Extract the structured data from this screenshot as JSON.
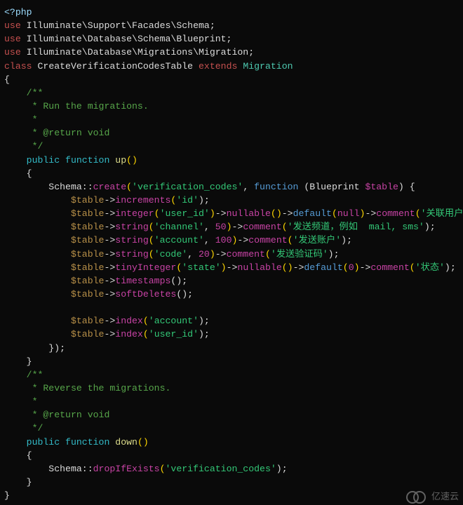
{
  "lines": {
    "l1": "<?php",
    "l2_use": "use",
    "l2_ns": " Illuminate\\Support\\Facades\\Schema;",
    "l3_use": "use",
    "l3_ns": " Illuminate\\Database\\Schema\\Blueprint;",
    "l4_use": "use",
    "l4_ns": " Illuminate\\Database\\Migrations\\Migration;",
    "l5_class": "class",
    "l5_name": " CreateVerificationCodesTable ",
    "l5_ext": "extends",
    "l5_parent": " Migration",
    "l6": "{",
    "l7": "    /**",
    "l8": "     * Run the migrations.",
    "l9": "     *",
    "l10": "     * @return void",
    "l11": "     */",
    "l12_pub": "    public",
    "l12_func": " function ",
    "l12_name": "up",
    "l12_paren": "()",
    "l13": "    {",
    "l14_schema": "        Schema",
    "l14_dcolon": "::",
    "l14_create": "create",
    "l14_open": "(",
    "l14_str": "'verification_codes'",
    "l14_comma": ", ",
    "l14_fn": "function ",
    "l14_op2": "(",
    "l14_bp": "Blueprint ",
    "l14_var": "$table",
    "l14_cl2": ") {",
    "l15_var": "            $table",
    "l15_arr": "->",
    "l15_m": "increments",
    "l15_op": "(",
    "l15_s": "'id'",
    "l15_cl": ");",
    "l16_var": "            $table",
    "l16_arr": "->",
    "l16_m1": "integer",
    "l16_op": "(",
    "l16_s1": "'user_id'",
    "l16_cl1": ")",
    "l16_a2": "->",
    "l16_m2": "nullable",
    "l16_p2": "()",
    "l16_a3": "->",
    "l16_m3": "default",
    "l16_p3o": "(",
    "l16_null": "null",
    "l16_p3c": ")",
    "l16_a4": "->",
    "l16_m4": "comment",
    "l16_p4o": "(",
    "l16_s4": "'关联用户'",
    "l16_end": ");",
    "l17_var": "            $table",
    "l17_a": "->",
    "l17_m": "string",
    "l17_op": "(",
    "l17_s1": "'channel'",
    "l17_c": ", ",
    "l17_n": "50",
    "l17_cl": ")",
    "l17_a2": "->",
    "l17_m2": "comment",
    "l17_op2": "(",
    "l17_s2": "'发送频道，例如  mail, sms'",
    "l17_end": ");",
    "l18_var": "            $table",
    "l18_a": "->",
    "l18_m": "string",
    "l18_op": "(",
    "l18_s1": "'account'",
    "l18_c": ", ",
    "l18_n": "100",
    "l18_cl": ")",
    "l18_a2": "->",
    "l18_m2": "comment",
    "l18_op2": "(",
    "l18_s2": "'发送账户'",
    "l18_end": ");",
    "l19_var": "            $table",
    "l19_a": "->",
    "l19_m": "string",
    "l19_op": "(",
    "l19_s1": "'code'",
    "l19_c": ", ",
    "l19_n": "20",
    "l19_cl": ")",
    "l19_a2": "->",
    "l19_m2": "comment",
    "l19_op2": "(",
    "l19_s2": "'发送验证码'",
    "l19_end": ");",
    "l20_var": "            $table",
    "l20_a": "->",
    "l20_m1": "tinyInteger",
    "l20_op": "(",
    "l20_s1": "'state'",
    "l20_cl1": ")",
    "l20_a2": "->",
    "l20_m2": "nullable",
    "l20_p2": "()",
    "l20_a3": "->",
    "l20_m3": "default",
    "l20_p3o": "(",
    "l20_zero": "0",
    "l20_p3c": ")",
    "l20_a4": "->",
    "l20_m4": "comment",
    "l20_p4o": "(",
    "l20_s4": "'状态'",
    "l20_end": ");",
    "l21_var": "            $table",
    "l21_a": "->",
    "l21_m": "timestamps",
    "l21_p": "();",
    "l22_var": "            $table",
    "l22_a": "->",
    "l22_m": "softDeletes",
    "l22_p": "();",
    "l23": " ",
    "l24_var": "            $table",
    "l24_a": "->",
    "l24_m": "index",
    "l24_op": "(",
    "l24_s": "'account'",
    "l24_cl": ");",
    "l25_var": "            $table",
    "l25_a": "->",
    "l25_m": "index",
    "l25_op": "(",
    "l25_s": "'user_id'",
    "l25_cl": ");",
    "l26": "        });",
    "l27": "    }",
    "l28": "    /**",
    "l29": "     * Reverse the migrations.",
    "l30": "     *",
    "l31": "     * @return void",
    "l32": "     */",
    "l33_pub": "    public",
    "l33_func": " function ",
    "l33_name": "down",
    "l33_paren": "()",
    "l34": "    {",
    "l35_schema": "        Schema",
    "l35_dcolon": "::",
    "l35_drop": "dropIfExists",
    "l35_op": "(",
    "l35_s": "'verification_codes'",
    "l35_cl": ");",
    "l36": "    }",
    "l37": "}"
  },
  "watermark": {
    "text": "亿速云"
  }
}
